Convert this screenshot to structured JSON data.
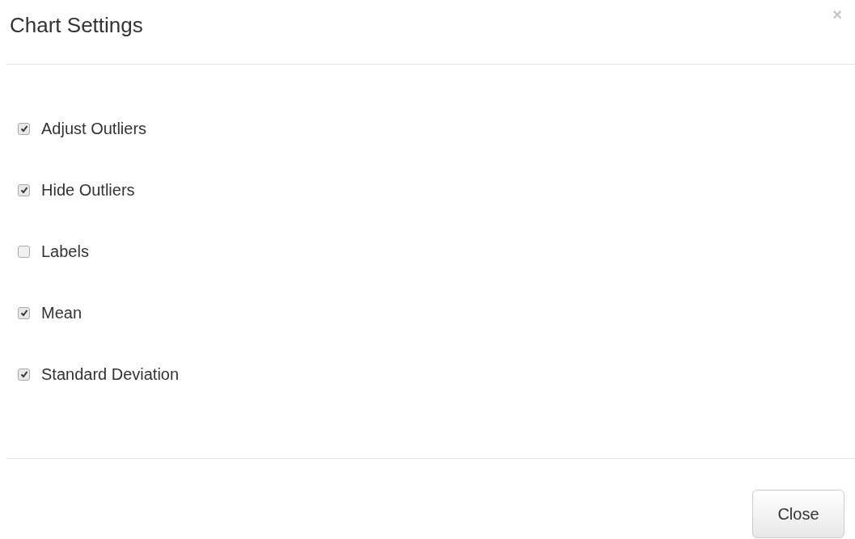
{
  "dialog": {
    "title": "Chart Settings",
    "close_icon": "×",
    "options": [
      {
        "label": "Adjust Outliers",
        "checked": true
      },
      {
        "label": "Hide Outliers",
        "checked": true
      },
      {
        "label": "Labels",
        "checked": false
      },
      {
        "label": "Mean",
        "checked": true
      },
      {
        "label": "Standard Deviation",
        "checked": true
      }
    ],
    "buttons": [
      "Close"
    ]
  }
}
